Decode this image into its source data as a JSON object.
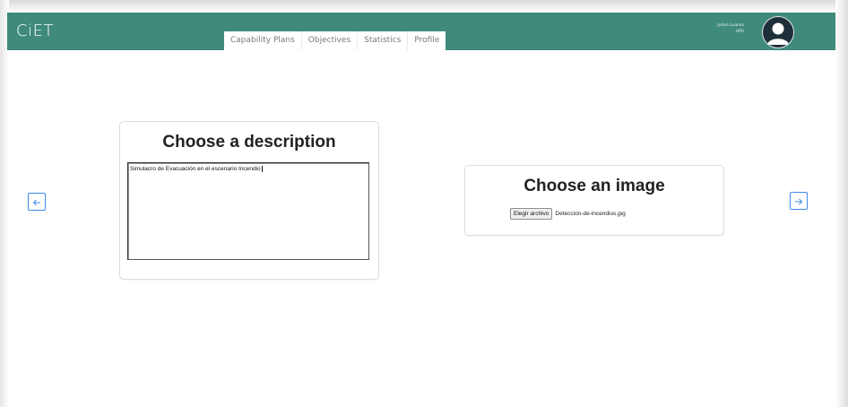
{
  "app": {
    "brand": "CiET",
    "colors": {
      "navbar": "#3f8a7a",
      "accent_button": "#3d8be8"
    }
  },
  "nav": {
    "tabs": [
      {
        "label": "Capability Plans"
      },
      {
        "label": "Objectives"
      },
      {
        "label": "Statistics"
      },
      {
        "label": "Profile"
      }
    ]
  },
  "user": {
    "name": "Julian Luanos",
    "org": "UPV",
    "avatar_icon": "user-avatar-icon"
  },
  "navigation_arrows": {
    "left_icon": "arrow-left-icon",
    "right_icon": "arrow-right-icon"
  },
  "description_card": {
    "title": "Choose a description",
    "textarea_value": "Simulacro de Evacuación en el escenario Incendio"
  },
  "image_card": {
    "title": "Choose an image",
    "file_button_label": "Elegir archivo",
    "file_name": "Deteccion-de-incendios.jpg"
  }
}
